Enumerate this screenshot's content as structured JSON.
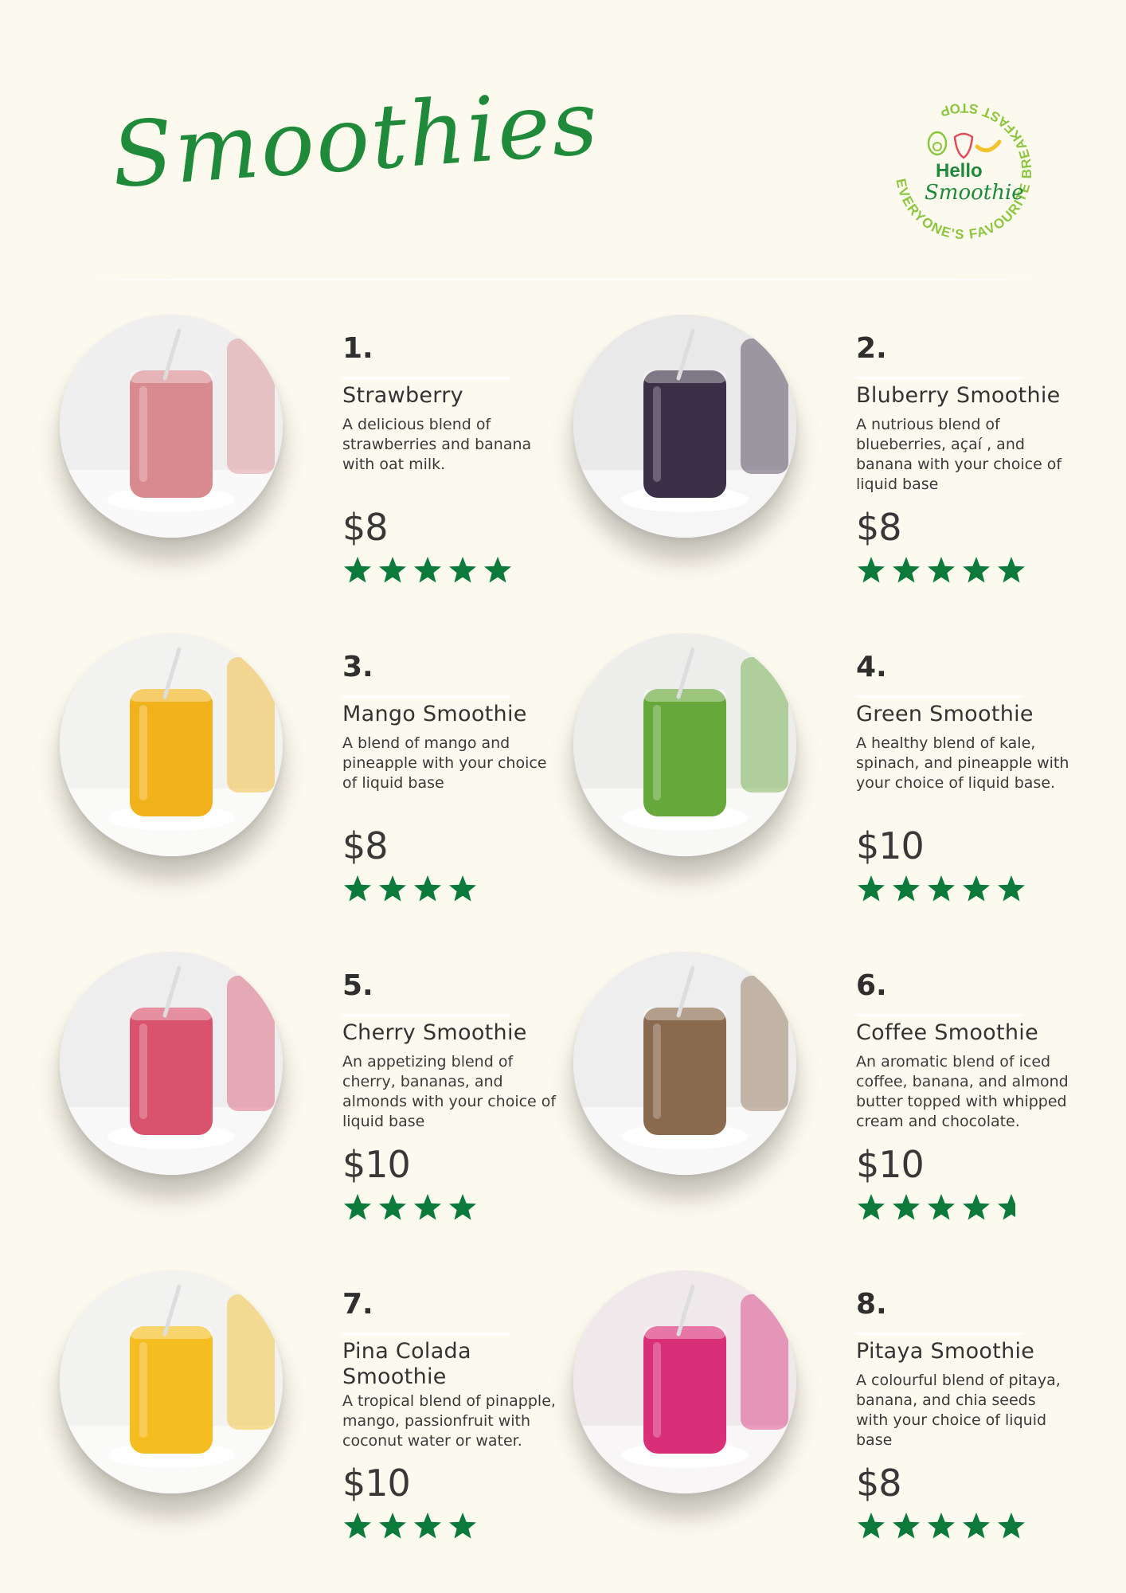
{
  "header": {
    "title": "Smoothies",
    "logo": {
      "hello": "Hello",
      "word": "Smoothie",
      "tagline": "EVERYONE'S FAVOURITE BREAKFAST STOP",
      "icons": [
        "avocado-icon",
        "strawberry-icon",
        "banana-icon"
      ]
    }
  },
  "colors": {
    "background": "#fcf9ee",
    "brand_green": "#1f8a3a",
    "star_green": "#0b7a3b",
    "text": "#333333"
  },
  "items": [
    {
      "number": "1.",
      "name": "Strawberry",
      "description": "A delicious blend of strawberries and banana with oat milk.",
      "price": "$8",
      "rating": 5,
      "drink_color": "#d98a8f",
      "background_color": "#efefef"
    },
    {
      "number": "2.",
      "name": "Bluberry Smoothie",
      "description": "A nutrious blend of blueberries, açaí , and banana with your choice of liquid base",
      "price": "$8",
      "rating": 5,
      "drink_color": "#3b3048",
      "background_color": "#e9e9ea"
    },
    {
      "number": "3.",
      "name": "Mango Smoothie",
      "description": "A blend of mango and pineapple with your choice of liquid base",
      "price": "$8",
      "rating": 4,
      "drink_color": "#f2b21c",
      "background_color": "#f2f2f1"
    },
    {
      "number": "4.",
      "name": "Green Smoothie",
      "description": "A healthy blend of kale, spinach, and pineapple with your choice of liquid base.",
      "price": "$10",
      "rating": 5,
      "drink_color": "#67a83a",
      "background_color": "#ededec"
    },
    {
      "number": "5.",
      "name": "Cherry Smoothie",
      "description": "An appetizing blend of cherry, bananas, and almonds with your choice of liquid base",
      "price": "$10",
      "rating": 4,
      "drink_color": "#d9536e",
      "background_color": "#efeeee"
    },
    {
      "number": "6.",
      "name": "Coffee Smoothie",
      "description": "An aromatic blend of iced coffee, banana, and almond butter topped with whipped cream and chocolate.",
      "price": "$10",
      "rating": 4.5,
      "drink_color": "#8a6a4e",
      "background_color": "#eeeeee"
    },
    {
      "number": "7.",
      "name": "Pina Colada Smoothie",
      "description": "A tropical blend of pinapple, mango, passionfruit with coconut water or water.",
      "price": "$10",
      "rating": 4,
      "drink_color": "#f5bd1f",
      "background_color": "#f2f2f1"
    },
    {
      "number": "8.",
      "name": "Pitaya Smoothie",
      "description": "A colourful blend of pitaya, banana, and chia seeds with your choice of liquid base",
      "price": "$8",
      "rating": 5,
      "drink_color": "#d92e78",
      "background_color": "#efe9ec"
    }
  ]
}
